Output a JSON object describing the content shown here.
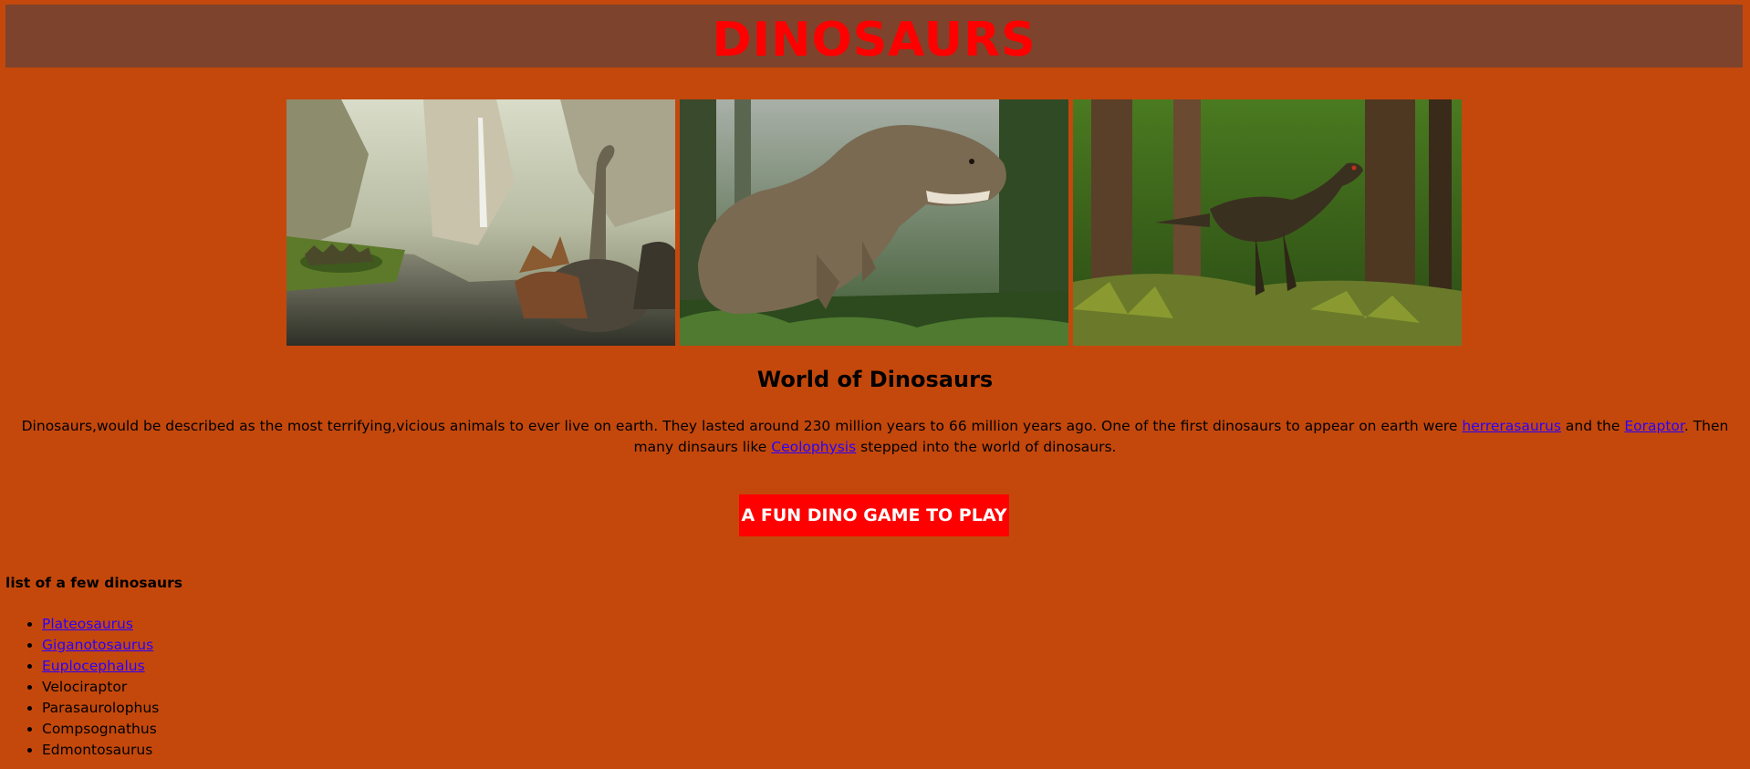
{
  "header": {
    "title": "DINOSAURS"
  },
  "gallery": [
    {
      "name": "prehistoric-landscape-photo"
    },
    {
      "name": "trex-photo"
    },
    {
      "name": "velociraptor-photo"
    }
  ],
  "main": {
    "subtitle": "World of Dinosaurs",
    "intro_part1": "Dinosaurs,would be described as the most terrifying,vicious animals to ever live on earth. They lasted around 230 million years to 66 million years ago. One of the first dinosaurs to appear on earth were ",
    "link1": "herrerasaurus",
    "intro_part2": " and the ",
    "link2": "Eoraptor",
    "intro_part3": ". Then many dinsaurs like ",
    "link3": "Ceolophysis",
    "intro_part4": " stepped into the world of dinosaurs.",
    "game_button": "A FUN DINO GAME TO PLAY"
  },
  "list": {
    "heading": "list of a few dinosaurs",
    "items": [
      {
        "label": "Plateosaurus",
        "link": true
      },
      {
        "label": "Giganotosaurus",
        "link": true
      },
      {
        "label": "Euplocephalus",
        "link": true
      },
      {
        "label": "Velociraptor",
        "link": false
      },
      {
        "label": "Parasaurolophus",
        "link": false
      },
      {
        "label": "Compsognathus",
        "link": false
      },
      {
        "label": "Edmontosaurus",
        "link": false
      }
    ]
  },
  "colors": {
    "background": "#c4480c",
    "header_bg": "#7e432c",
    "title": "#ff0000",
    "button_bg": "#ff0000",
    "link": "#2b00ff"
  }
}
